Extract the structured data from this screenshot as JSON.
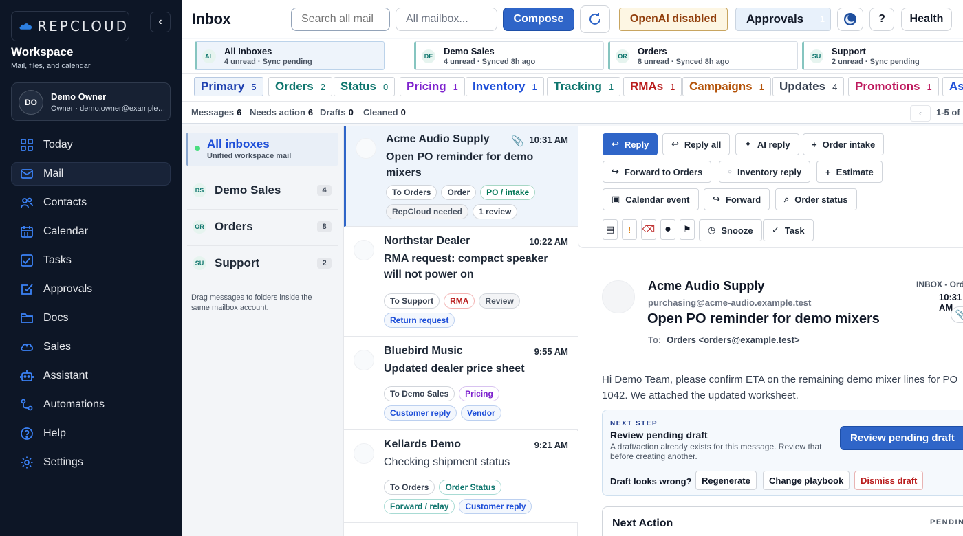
{
  "brand": {
    "logo_text": "REPCLOUD"
  },
  "workspace": {
    "title": "Workspace",
    "subtitle": "Mail, files, and calendar"
  },
  "user": {
    "initials": "DO",
    "name": "Demo Owner",
    "role": "Owner · demo.owner@example.test"
  },
  "nav": [
    {
      "label": "Today",
      "icon": "grid-icon",
      "active": false
    },
    {
      "label": "Mail",
      "icon": "mail-icon",
      "active": true
    },
    {
      "label": "Contacts",
      "icon": "people-icon",
      "active": false
    },
    {
      "label": "Calendar",
      "icon": "calendar-icon",
      "active": false
    },
    {
      "label": "Tasks",
      "icon": "checklist-icon",
      "active": false
    },
    {
      "label": "Approvals",
      "icon": "checkbox-icon",
      "active": false
    },
    {
      "label": "Docs",
      "icon": "folder-icon",
      "active": false
    },
    {
      "label": "Sales",
      "icon": "cloud-icon",
      "active": false
    },
    {
      "label": "Assistant",
      "icon": "robot-icon",
      "active": false
    },
    {
      "label": "Automations",
      "icon": "flow-icon",
      "active": false
    },
    {
      "label": "Help",
      "icon": "help-icon",
      "active": false
    },
    {
      "label": "Settings",
      "icon": "gear-icon",
      "active": false
    }
  ],
  "topbar": {
    "title": "Inbox",
    "search_placeholder": "Search all mail",
    "mailbox_select": "All mailbox...",
    "compose": "Compose",
    "openai": "OpenAI disabled",
    "approvals": "Approvals",
    "approvals_count": "1",
    "help": "?",
    "health": "Health"
  },
  "mailboxes": [
    {
      "badge": "AL",
      "title": "All Inboxes",
      "sub": "4 unread · Sync pending",
      "active": true
    },
    {
      "badge": "DE",
      "title": "Demo Sales",
      "sub": "4 unread · Synced 8h ago",
      "active": false
    },
    {
      "badge": "OR",
      "title": "Orders",
      "sub": "8 unread · Synced 8h ago",
      "active": false
    },
    {
      "badge": "SU",
      "title": "Support",
      "sub": "2 unread · Sync pending",
      "active": false
    }
  ],
  "tabs": [
    {
      "label": "Primary",
      "count": "5",
      "color": "#1e40af",
      "active": true
    },
    {
      "label": "Orders",
      "count": "2",
      "color": "#0f766e"
    },
    {
      "label": "Status",
      "count": "0",
      "color": "#0f766e"
    },
    {
      "label": "Pricing",
      "count": "1",
      "color": "#7e22ce"
    },
    {
      "label": "Inventory",
      "count": "1",
      "color": "#1d4ed8"
    },
    {
      "label": "Tracking",
      "count": "1",
      "color": "#0f766e"
    },
    {
      "label": "RMAs",
      "count": "1",
      "color": "#b91c1c"
    },
    {
      "label": "Campaigns",
      "count": "1",
      "color": "#b45309"
    },
    {
      "label": "Updates",
      "count": "4",
      "color": "#374151"
    },
    {
      "label": "Promotions",
      "count": "1",
      "color": "#be185d"
    },
    {
      "label": "Ass",
      "count": "",
      "color": "#1d4ed8"
    }
  ],
  "stats": {
    "messages_label": "Messages",
    "messages": "6",
    "needs_label": "Needs action",
    "needs": "6",
    "drafts_label": "Drafts",
    "drafts": "0",
    "cleaned_label": "Cleaned",
    "cleaned": "0",
    "pager": "1-5 of"
  },
  "folders": {
    "all_title": "All inboxes",
    "all_sub": "Unified workspace mail",
    "items": [
      {
        "badge": "DS",
        "name": "Demo Sales",
        "count": "4"
      },
      {
        "badge": "OR",
        "name": "Orders",
        "count": "8"
      },
      {
        "badge": "SU",
        "name": "Support",
        "count": "2"
      }
    ],
    "hint": "Drag messages to folders inside the same mailbox account."
  },
  "messages": [
    {
      "from": "Acme Audio Supply",
      "time": "10:31 AM",
      "attachment": true,
      "subject": "Open PO reminder for demo mixers",
      "bold": true,
      "chips": [
        [
          "To Orders",
          "gray"
        ],
        [
          "Order",
          "gray"
        ],
        [
          "PO / intake",
          "green"
        ],
        [
          "RepCloud needed",
          "muted"
        ],
        [
          "1 review",
          "gray"
        ]
      ]
    },
    {
      "from": "Northstar Dealer",
      "time": "10:22 AM",
      "attachment": false,
      "subject": "RMA request: compact speaker will not power on",
      "bold": true,
      "chips": [
        [
          "To Support",
          "gray"
        ],
        [
          "RMA",
          "red"
        ],
        [
          "Review",
          "muted"
        ],
        [
          "Return request",
          "blue"
        ]
      ]
    },
    {
      "from": "Bluebird Music",
      "time": "9:55 AM",
      "attachment": false,
      "subject": "Updated dealer price sheet",
      "bold": true,
      "chips": [
        [
          "To Demo Sales",
          "gray"
        ],
        [
          "Pricing",
          "purple"
        ],
        [
          "Customer reply",
          "blue"
        ],
        [
          "Vendor",
          "blue"
        ]
      ]
    },
    {
      "from": "Kellards Demo",
      "time": "9:21 AM",
      "attachment": false,
      "subject": "Checking shipment status",
      "bold": false,
      "chips": [
        [
          "To Orders",
          "gray"
        ],
        [
          "Order Status",
          "teal"
        ],
        [
          "Forward / relay",
          "teal"
        ],
        [
          "Customer reply",
          "blue"
        ]
      ]
    }
  ],
  "actions": {
    "reply": "Reply",
    "reply_all": "Reply all",
    "ai_reply": "AI reply",
    "order_intake": "Order intake",
    "forward_orders": "Forward to Orders",
    "inventory_reply": "Inventory reply",
    "estimate": "Estimate",
    "calendar_event": "Calendar event",
    "forward": "Forward",
    "order_status": "Order status",
    "snooze": "Snooze",
    "task": "Task"
  },
  "email": {
    "from": "Acme Audio Supply",
    "address": "purchasing@acme-audio.example.test",
    "subject": "Open PO reminder for demo mixers",
    "to_label": "To:",
    "to": "Orders <orders@example.test>",
    "meta": "INBOX - Orders",
    "time": "10:31 AM",
    "body": "Hi Demo Team, please confirm ETA on the remaining demo mixer lines for PO 1042. We attached the updated worksheet."
  },
  "next_step": {
    "kicker": "NEXT STEP",
    "title": "Review pending draft",
    "desc": "A draft/action already exists for this message. Review that before creating another.",
    "button": "Review pending draft",
    "draft_label": "Draft looks wrong?",
    "regenerate": "Regenerate",
    "change_playbook": "Change playbook",
    "dismiss": "Dismiss draft"
  },
  "next_action": {
    "title": "Next Action",
    "status": "PENDING"
  }
}
